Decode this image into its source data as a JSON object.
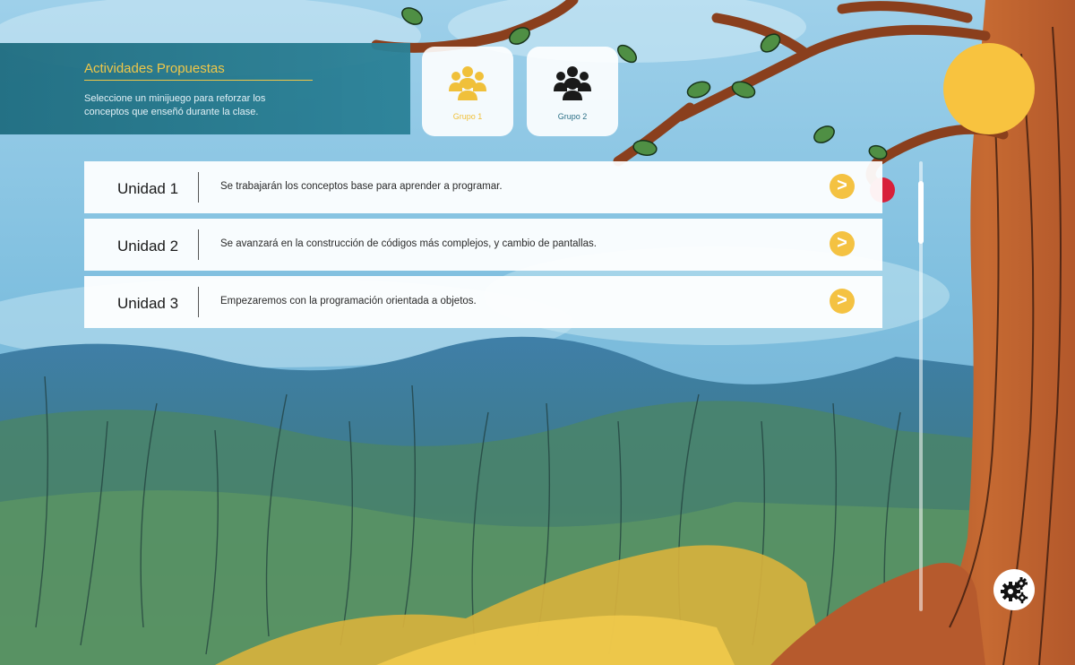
{
  "header": {
    "title": "Actividades Propuestas",
    "description": "Seleccione un minijuego para reforzar los conceptos que enseñó durante la clase."
  },
  "groups": [
    {
      "label": "Grupo 1",
      "icon": "group-icon",
      "color": "#f0c03a"
    },
    {
      "label": "Grupo 2",
      "icon": "group-icon",
      "color": "#1a1a1a"
    }
  ],
  "units": [
    {
      "title": "Unidad 1",
      "description": "Se trabajarán los conceptos base para aprender a programar.",
      "action_icon": ">"
    },
    {
      "title": "Unidad 2",
      "description": "Se avanzará en la construcción de códigos más complejos, y cambio de pantallas.",
      "action_icon": ">"
    },
    {
      "title": "Unidad 3",
      "description": "Empezaremos con la programación orientada a objetos.",
      "action_icon": ">"
    }
  ],
  "colors": {
    "accent": "#f4c242",
    "header_bg": "#1f6d80",
    "sun": "#f8c33f"
  },
  "icons": {
    "settings": "gears-icon",
    "arrow": "chevron-right-icon"
  }
}
